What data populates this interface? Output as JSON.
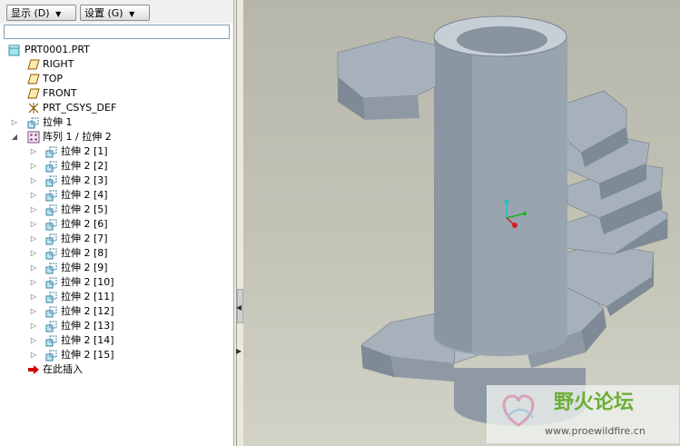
{
  "toolbar": {
    "show_label": "显示 (D)",
    "settings_label": "设置 (G)"
  },
  "tree": {
    "root": "PRT0001.PRT",
    "datum_right": "RIGHT",
    "datum_top": "TOP",
    "datum_front": "FRONT",
    "csys": "PRT_CSYS_DEF",
    "extrude1": "拉伸 1",
    "pattern": "阵列 1 / 拉伸 2",
    "pattern_items": [
      "拉伸 2 [1]",
      "拉伸 2 [2]",
      "拉伸 2 [3]",
      "拉伸 2 [4]",
      "拉伸 2 [5]",
      "拉伸 2 [6]",
      "拉伸 2 [7]",
      "拉伸 2 [8]",
      "拉伸 2 [9]",
      "拉伸 2 [10]",
      "拉伸 2 [11]",
      "拉伸 2 [12]",
      "拉伸 2 [13]",
      "拉伸 2 [14]",
      "拉伸 2 [15]"
    ],
    "insert_here": "在此插入"
  },
  "watermark": {
    "title": "野火论坛",
    "url": "www.proewildfire.cn"
  },
  "colors": {
    "viewport_bg": "#c3c3b6",
    "part_face": "#a6b1bc",
    "part_dark": "#7e8a96",
    "part_light": "#c6ced6",
    "watermark_green": "#6cae36"
  }
}
